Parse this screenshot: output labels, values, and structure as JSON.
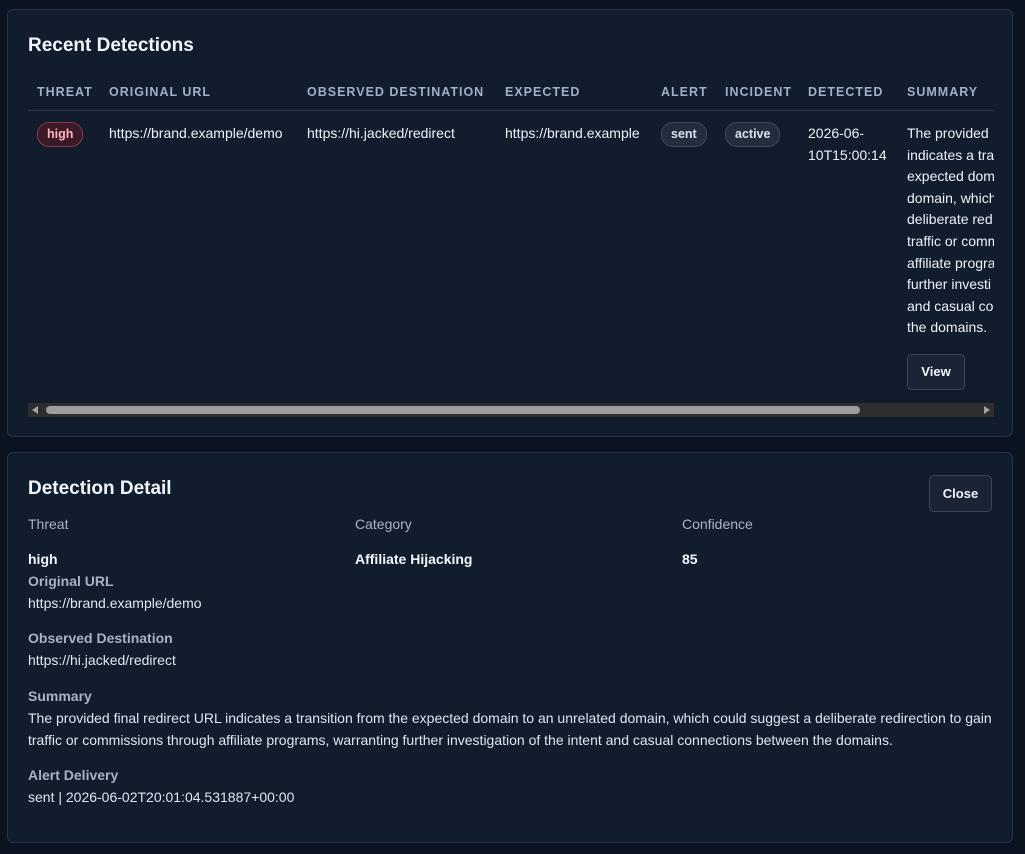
{
  "recent": {
    "title": "Recent Detections",
    "columns": [
      "THREAT",
      "ORIGINAL URL",
      "OBSERVED DESTINATION",
      "EXPECTED",
      "ALERT",
      "INCIDENT",
      "DETECTED",
      "SUMMARY"
    ],
    "rows": [
      {
        "threat": "high",
        "original_url": "https://brand.example/demo",
        "observed_destination": "https://hi.jacked/redirect",
        "expected": "https://brand.example",
        "alert": "sent",
        "incident": "active",
        "detected_line1": "2026-06-",
        "detected_line2": "10T15:00:14",
        "summary_lines": [
          "The provided",
          "indicates a tra",
          "expected dom",
          "domain, which",
          "deliberate red",
          "traffic or comm",
          "affiliate progra",
          "further investi",
          "and casual co",
          "the domains."
        ],
        "view_label": "View"
      }
    ]
  },
  "detail": {
    "title": "Detection Detail",
    "close_label": "Close",
    "threat_label": "Threat",
    "threat_value": "high",
    "category_label": "Category",
    "category_value": "Affiliate Hijacking",
    "confidence_label": "Confidence",
    "confidence_value": "85",
    "original_url_label": "Original URL",
    "original_url_value": "https://brand.example/demo",
    "observed_label": "Observed Destination",
    "observed_value": "https://hi.jacked/redirect",
    "summary_label": "Summary",
    "summary_value": "The provided final redirect URL indicates a transition from the expected domain to an unrelated domain, which could suggest a deliberate redirection to gain traffic or commissions through affiliate programs, warranting further investigation of the intent and casual connections between the domains.",
    "alert_label": "Alert Delivery",
    "alert_value": "sent | 2026-06-02T20:01:04.531887+00:00"
  }
}
